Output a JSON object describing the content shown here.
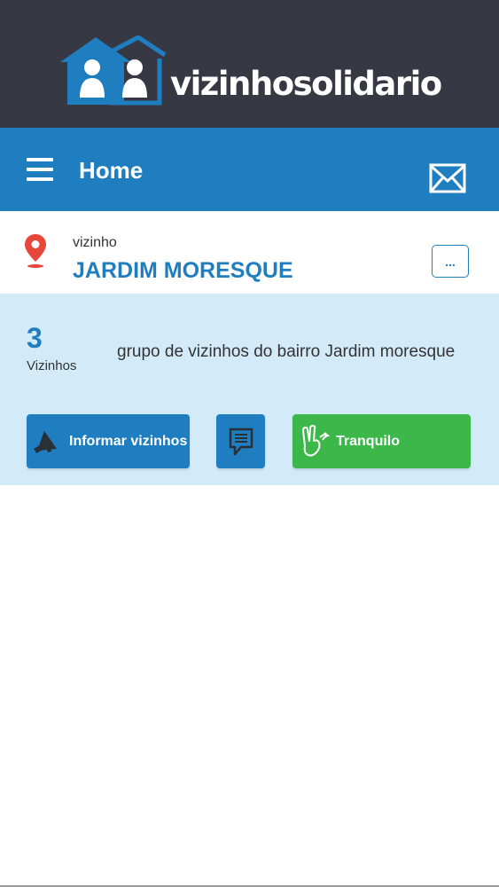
{
  "brand": {
    "name": "vizinhosolidario",
    "logo_icon": "two-people-houses-icon"
  },
  "appbar": {
    "menu_icon": "hamburger-menu-icon",
    "title": "Home",
    "mail_icon": "envelope-icon"
  },
  "location": {
    "pin_icon": "map-pin-icon",
    "label": "vizinho",
    "name": "JARDIM MORESQUE",
    "more_label": "..."
  },
  "group": {
    "count": "3",
    "count_label": "Vizinhos",
    "description": "grupo de vizinhos do bairro Jardim moresque"
  },
  "actions": {
    "inform": {
      "label": "Informar vizinhos",
      "icon": "megaphone-icon"
    },
    "chat": {
      "icon": "chat-bubble-icon"
    },
    "calm": {
      "label": "Tranquilo",
      "icon": "peace-hand-icon"
    }
  },
  "colors": {
    "header_dark": "#363844",
    "primary_blue": "#1f7ec0",
    "panel_light_blue": "#d3ebf8",
    "success_green": "#3cb84a",
    "pin_red": "#e8473b"
  }
}
